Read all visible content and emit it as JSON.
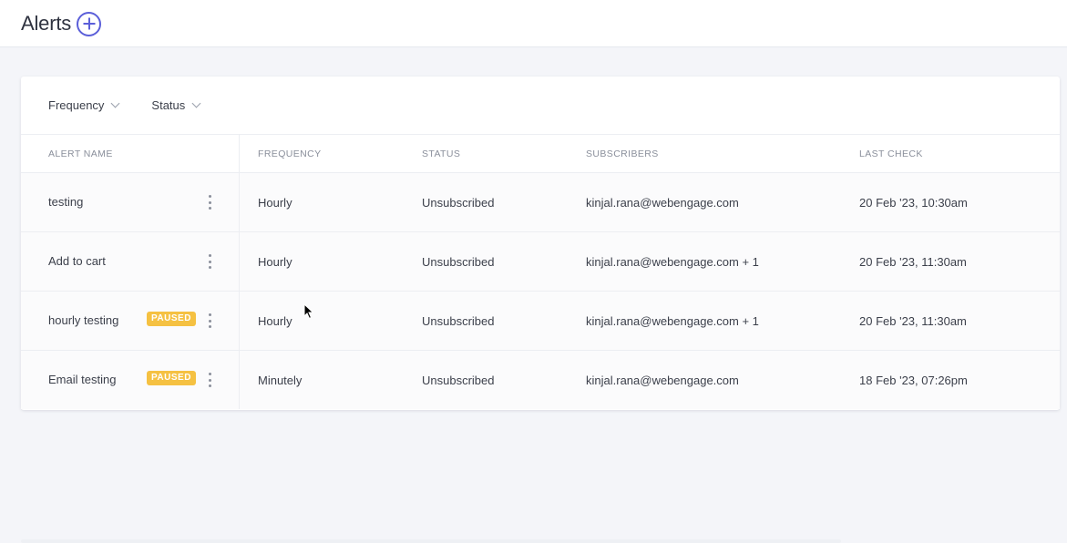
{
  "header": {
    "title": "Alerts"
  },
  "filters": [
    {
      "label": "Frequency"
    },
    {
      "label": "Status"
    }
  ],
  "table": {
    "columns": [
      "ALERT NAME",
      "FREQUENCY",
      "STATUS",
      "SUBSCRIBERS",
      "LAST CHECK"
    ],
    "rows": [
      {
        "name": "testing",
        "badge": "",
        "frequency": "Hourly",
        "status": "Unsubscribed",
        "subscribers": "kinjal.rana@webengage.com",
        "last_check": "20 Feb '23, 10:30am"
      },
      {
        "name": "Add to cart",
        "badge": "",
        "frequency": "Hourly",
        "status": "Unsubscribed",
        "subscribers": "kinjal.rana@webengage.com + 1",
        "last_check": "20 Feb '23, 11:30am"
      },
      {
        "name": "hourly testing",
        "badge": "PAUSED",
        "frequency": "Hourly",
        "status": "Unsubscribed",
        "subscribers": "kinjal.rana@webengage.com + 1",
        "last_check": "20 Feb '23, 11:30am"
      },
      {
        "name": "Email testing",
        "badge": "PAUSED",
        "frequency": "Minutely",
        "status": "Unsubscribed",
        "subscribers": "kinjal.rana@webengage.com",
        "last_check": "18 Feb '23, 07:26pm"
      }
    ]
  },
  "icons": {
    "add": "plus-circle-icon",
    "filter_chevron": "chevron-down-icon",
    "row_menu": "kebab-menu-icon"
  },
  "colors": {
    "accent": "#5b5fd9",
    "paused_badge": "#f5c142",
    "background": "#f4f5f9"
  }
}
